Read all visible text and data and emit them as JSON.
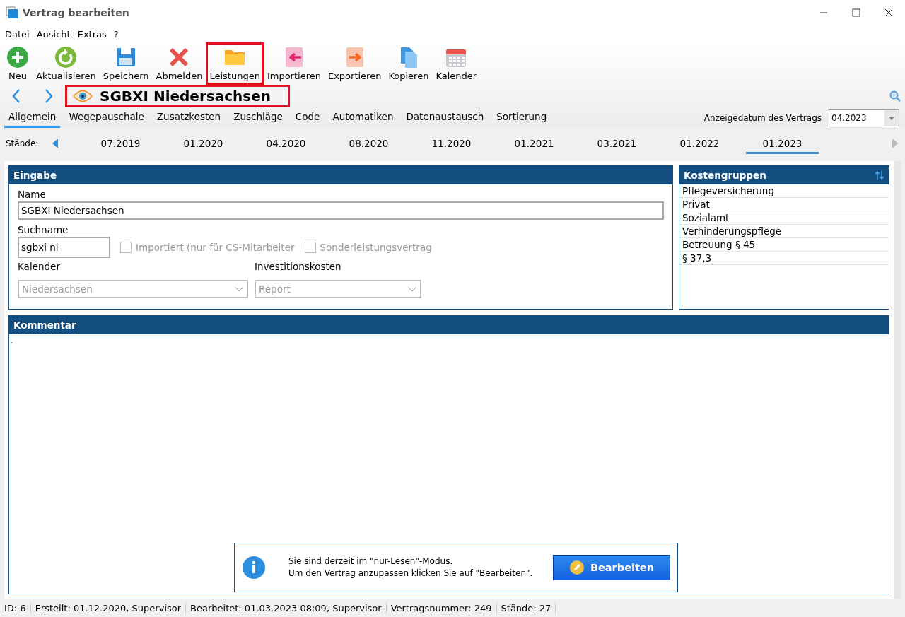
{
  "window": {
    "title": "Vertrag bearbeiten"
  },
  "menu": [
    "Datei",
    "Ansicht",
    "Extras",
    "?"
  ],
  "toolbar": [
    {
      "kind": "add",
      "label": "Neu",
      "highlighted": false
    },
    {
      "kind": "refresh",
      "label": "Aktualisieren",
      "highlighted": false
    },
    {
      "kind": "save",
      "label": "Speichern",
      "highlighted": false
    },
    {
      "kind": "logout",
      "label": "Abmelden",
      "highlighted": false
    },
    {
      "kind": "folder",
      "label": "Leistungen",
      "highlighted": true
    },
    {
      "kind": "import",
      "label": "Importieren",
      "highlighted": false
    },
    {
      "kind": "export",
      "label": "Exportieren",
      "highlighted": false
    },
    {
      "kind": "copy",
      "label": "Kopieren",
      "highlighted": false
    },
    {
      "kind": "calendar",
      "label": "Kalender",
      "highlighted": false
    }
  ],
  "record": {
    "title": "SGBXI Niedersachsen",
    "highlighted": true
  },
  "tabs": [
    {
      "label": "Allgemein",
      "selected": true
    },
    {
      "label": "Wegepauschale",
      "selected": false
    },
    {
      "label": "Zusatzkosten",
      "selected": false
    },
    {
      "label": "Zuschläge",
      "selected": false
    },
    {
      "label": "Code",
      "selected": false
    },
    {
      "label": "Automatiken",
      "selected": false
    },
    {
      "label": "Datenaustausch",
      "selected": false
    },
    {
      "label": "Sortierung",
      "selected": false
    }
  ],
  "display_date": {
    "label": "Anzeigedatum des Vertrags",
    "value": "04.2023"
  },
  "versions": {
    "label": "Stände:",
    "items": [
      {
        "label": "07.2019",
        "selected": false
      },
      {
        "label": "01.2020",
        "selected": false
      },
      {
        "label": "04.2020",
        "selected": false
      },
      {
        "label": "08.2020",
        "selected": false
      },
      {
        "label": "11.2020",
        "selected": false
      },
      {
        "label": "01.2021",
        "selected": false
      },
      {
        "label": "03.2021",
        "selected": false
      },
      {
        "label": "01.2022",
        "selected": false
      },
      {
        "label": "01.2023",
        "selected": true
      }
    ]
  },
  "input_panel": {
    "title": "Eingabe",
    "name_label": "Name",
    "name_value": "SGBXI Niedersachsen",
    "search_label": "Suchname",
    "search_value": "sgbxi ni",
    "checkboxes": [
      {
        "label": "Importiert (nur für CS-Mitarbeiter",
        "checked": false
      },
      {
        "label": "Sonderleistungsvertrag",
        "checked": false
      }
    ],
    "calendar_label": "Kalender",
    "calendar_value": "Niedersachsen",
    "invest_label": "Investitionskosten",
    "invest_value": "Report"
  },
  "cost_groups": {
    "title": "Kostengruppen",
    "items": [
      "Pflegeversicherung",
      "Privat",
      "Sozialamt",
      "Verhinderungspflege",
      "Betreuung § 45",
      "§ 37,3"
    ]
  },
  "comment": {
    "title": "Kommentar",
    "value": "."
  },
  "notice": {
    "lines": [
      "Sie sind derzeit im \"nur-Lesen\"-Modus.",
      "Um den Vertrag anzupassen klicken Sie auf \"Bearbeiten\"."
    ],
    "button": "Bearbeiten"
  },
  "status_bar": [
    "ID: 6",
    "Erstellt: 01.12.2020, Supervisor",
    "Bearbeitet: 01.03.2023 08:09, Supervisor",
    "Vertragsnummer: 249",
    "Stände: 27"
  ]
}
